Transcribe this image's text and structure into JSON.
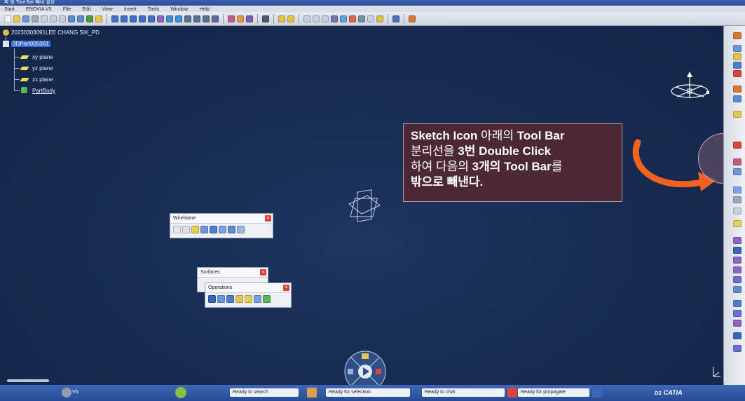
{
  "window": {
    "title": "파 를 Tool Bar 빼내 설정"
  },
  "menu": [
    "Start",
    "ENOVIA V5",
    "File",
    "Edit",
    "View",
    "Insert",
    "Tools",
    "Window",
    "Help"
  ],
  "tree": {
    "root": "20230303091LEE CHANG SIK_PD",
    "part": "3DPart005061",
    "planes": [
      "xy plane",
      "yz plane",
      "zx plane"
    ],
    "body": "PartBody"
  },
  "toolbars": {
    "wireframe": {
      "title": "Wireframe",
      "close": "×"
    },
    "surfaces": {
      "title": "Surfaces",
      "close": "×"
    },
    "operations": {
      "title": "Operations",
      "close": "×"
    }
  },
  "callout": {
    "line1_en": "Sketch Icon",
    "line1_ko": " 아래의 ",
    "line1_en2": "Tool Bar",
    "line2_ko": "분리선을 ",
    "line2_en": "3번 Double Click",
    "line3_ko": "하여 다음의 ",
    "line3_en": "3개의 Tool Bar",
    "line3_ko2": "를",
    "line4_ko": "밖으로 빼낸다."
  },
  "status": {
    "search": "Ready to search",
    "selection": "Ready for selection",
    "chat": "Ready to chat",
    "propagate": "Ready for propagate",
    "brand": "CATIA",
    "ver": "V5"
  },
  "colors": {
    "accent_arrow": "#f2611d",
    "callout_bg": "#4c2735",
    "viewport_bg": "#1a2f55"
  }
}
